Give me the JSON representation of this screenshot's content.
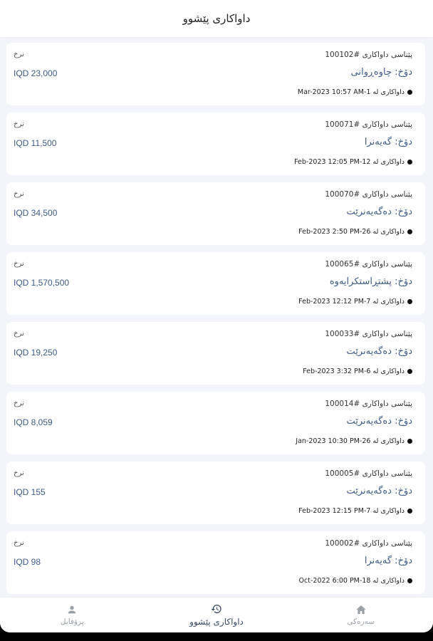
{
  "header": {
    "title": "داواکاری پێشوو"
  },
  "orders": [
    {
      "id_label": "پێناسی داواکاری #100102",
      "status": "دۆخ: چاوەڕوانی",
      "date": "داواکاری لە 1-Mar-2023 10:57 AM",
      "currency_word": "نرخ",
      "price": "IQD 23,000"
    },
    {
      "id_label": "پێناسی داواکاری #100071",
      "status": "دۆخ: گەیەنرا",
      "date": "داواکاری لە 12-Feb-2023 12:05 PM",
      "currency_word": "نرخ",
      "price": "IQD 11,500"
    },
    {
      "id_label": "پێناسی داواکاری #100070",
      "status": "دۆخ: دەگەیەنرێت",
      "date": "داواکاری لە 26-Feb-2023 2:50 PM",
      "currency_word": "نرخ",
      "price": "IQD 34,500"
    },
    {
      "id_label": "پێناسی داواکاری #100065",
      "status": "دۆخ: پشتڕاستکرایەوە",
      "date": "داواکاری لە 7-Feb-2023 12:12 PM",
      "currency_word": "نرخ",
      "price": "IQD 1,570,500"
    },
    {
      "id_label": "پێناسی داواکاری #100033",
      "status": "دۆخ: دەگەیەنرێت",
      "date": "داواکاری لە 6-Feb-2023 3:32 PM",
      "currency_word": "نرخ",
      "price": "IQD 19,250"
    },
    {
      "id_label": "پێناسی داواکاری #100014",
      "status": "دۆخ: دەگەیەنرێت",
      "date": "داواکاری لە 26-Jan-2023 10:30 PM",
      "currency_word": "نرخ",
      "price": "IQD 8,059"
    },
    {
      "id_label": "پێناسی داواکاری #100005",
      "status": "دۆخ: دەگەیەنرێت",
      "date": "داواکاری لە 7-Feb-2023 12:15 PM",
      "currency_word": "نرخ",
      "price": "IQD 155"
    },
    {
      "id_label": "پێناسی داواکاری #100002",
      "status": "دۆخ: گەیەنرا",
      "date": "داواکاری لە 18-Oct-2022 6:00 PM",
      "currency_word": "نرخ",
      "price": "IQD 98"
    }
  ],
  "bottom_nav": {
    "items": [
      {
        "label": "سەرەکی",
        "icon": "home-icon",
        "active": false
      },
      {
        "label": "داواکاری پێشوو",
        "icon": "history-icon",
        "active": true
      },
      {
        "label": "پرۆفایل",
        "icon": "person-icon",
        "active": false
      }
    ]
  },
  "colors": {
    "accent": "#3e5a86",
    "background": "#f3f5fa",
    "card": "#ffffff"
  }
}
